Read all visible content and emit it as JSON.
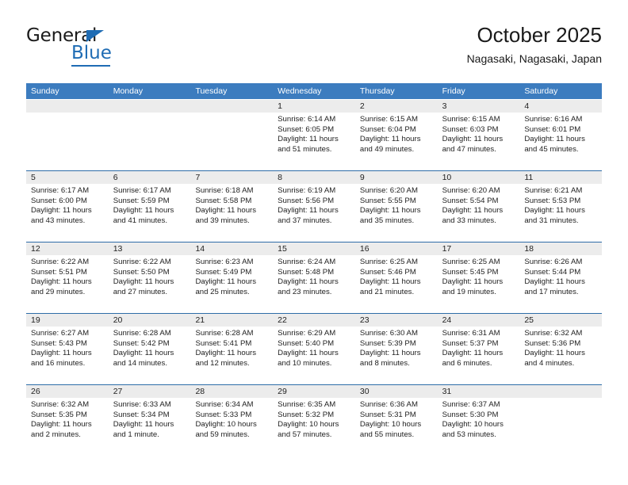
{
  "brand": {
    "name_top": "General",
    "name_bottom": "Blue",
    "accent_color": "#1f6cb4",
    "triangle_icon": "logo-triangle-icon"
  },
  "header": {
    "title": "October 2025",
    "subtitle": "Nagasaki, Nagasaki, Japan"
  },
  "calendar": {
    "header_bg": "#3c7cbf",
    "row_rule_color": "#2e6da8",
    "daynum_bg": "#ececec",
    "weekdays": [
      "Sunday",
      "Monday",
      "Tuesday",
      "Wednesday",
      "Thursday",
      "Friday",
      "Saturday"
    ],
    "weeks": [
      [
        {
          "day": "",
          "empty": true,
          "sunrise": "",
          "sunset": "",
          "daylight_line1": "",
          "daylight_line2": ""
        },
        {
          "day": "",
          "empty": true,
          "sunrise": "",
          "sunset": "",
          "daylight_line1": "",
          "daylight_line2": ""
        },
        {
          "day": "",
          "empty": true,
          "sunrise": "",
          "sunset": "",
          "daylight_line1": "",
          "daylight_line2": ""
        },
        {
          "day": "1",
          "empty": false,
          "sunrise": "Sunrise: 6:14 AM",
          "sunset": "Sunset: 6:05 PM",
          "daylight_line1": "Daylight: 11 hours",
          "daylight_line2": "and 51 minutes."
        },
        {
          "day": "2",
          "empty": false,
          "sunrise": "Sunrise: 6:15 AM",
          "sunset": "Sunset: 6:04 PM",
          "daylight_line1": "Daylight: 11 hours",
          "daylight_line2": "and 49 minutes."
        },
        {
          "day": "3",
          "empty": false,
          "sunrise": "Sunrise: 6:15 AM",
          "sunset": "Sunset: 6:03 PM",
          "daylight_line1": "Daylight: 11 hours",
          "daylight_line2": "and 47 minutes."
        },
        {
          "day": "4",
          "empty": false,
          "sunrise": "Sunrise: 6:16 AM",
          "sunset": "Sunset: 6:01 PM",
          "daylight_line1": "Daylight: 11 hours",
          "daylight_line2": "and 45 minutes."
        }
      ],
      [
        {
          "day": "5",
          "empty": false,
          "sunrise": "Sunrise: 6:17 AM",
          "sunset": "Sunset: 6:00 PM",
          "daylight_line1": "Daylight: 11 hours",
          "daylight_line2": "and 43 minutes."
        },
        {
          "day": "6",
          "empty": false,
          "sunrise": "Sunrise: 6:17 AM",
          "sunset": "Sunset: 5:59 PM",
          "daylight_line1": "Daylight: 11 hours",
          "daylight_line2": "and 41 minutes."
        },
        {
          "day": "7",
          "empty": false,
          "sunrise": "Sunrise: 6:18 AM",
          "sunset": "Sunset: 5:58 PM",
          "daylight_line1": "Daylight: 11 hours",
          "daylight_line2": "and 39 minutes."
        },
        {
          "day": "8",
          "empty": false,
          "sunrise": "Sunrise: 6:19 AM",
          "sunset": "Sunset: 5:56 PM",
          "daylight_line1": "Daylight: 11 hours",
          "daylight_line2": "and 37 minutes."
        },
        {
          "day": "9",
          "empty": false,
          "sunrise": "Sunrise: 6:20 AM",
          "sunset": "Sunset: 5:55 PM",
          "daylight_line1": "Daylight: 11 hours",
          "daylight_line2": "and 35 minutes."
        },
        {
          "day": "10",
          "empty": false,
          "sunrise": "Sunrise: 6:20 AM",
          "sunset": "Sunset: 5:54 PM",
          "daylight_line1": "Daylight: 11 hours",
          "daylight_line2": "and 33 minutes."
        },
        {
          "day": "11",
          "empty": false,
          "sunrise": "Sunrise: 6:21 AM",
          "sunset": "Sunset: 5:53 PM",
          "daylight_line1": "Daylight: 11 hours",
          "daylight_line2": "and 31 minutes."
        }
      ],
      [
        {
          "day": "12",
          "empty": false,
          "sunrise": "Sunrise: 6:22 AM",
          "sunset": "Sunset: 5:51 PM",
          "daylight_line1": "Daylight: 11 hours",
          "daylight_line2": "and 29 minutes."
        },
        {
          "day": "13",
          "empty": false,
          "sunrise": "Sunrise: 6:22 AM",
          "sunset": "Sunset: 5:50 PM",
          "daylight_line1": "Daylight: 11 hours",
          "daylight_line2": "and 27 minutes."
        },
        {
          "day": "14",
          "empty": false,
          "sunrise": "Sunrise: 6:23 AM",
          "sunset": "Sunset: 5:49 PM",
          "daylight_line1": "Daylight: 11 hours",
          "daylight_line2": "and 25 minutes."
        },
        {
          "day": "15",
          "empty": false,
          "sunrise": "Sunrise: 6:24 AM",
          "sunset": "Sunset: 5:48 PM",
          "daylight_line1": "Daylight: 11 hours",
          "daylight_line2": "and 23 minutes."
        },
        {
          "day": "16",
          "empty": false,
          "sunrise": "Sunrise: 6:25 AM",
          "sunset": "Sunset: 5:46 PM",
          "daylight_line1": "Daylight: 11 hours",
          "daylight_line2": "and 21 minutes."
        },
        {
          "day": "17",
          "empty": false,
          "sunrise": "Sunrise: 6:25 AM",
          "sunset": "Sunset: 5:45 PM",
          "daylight_line1": "Daylight: 11 hours",
          "daylight_line2": "and 19 minutes."
        },
        {
          "day": "18",
          "empty": false,
          "sunrise": "Sunrise: 6:26 AM",
          "sunset": "Sunset: 5:44 PM",
          "daylight_line1": "Daylight: 11 hours",
          "daylight_line2": "and 17 minutes."
        }
      ],
      [
        {
          "day": "19",
          "empty": false,
          "sunrise": "Sunrise: 6:27 AM",
          "sunset": "Sunset: 5:43 PM",
          "daylight_line1": "Daylight: 11 hours",
          "daylight_line2": "and 16 minutes."
        },
        {
          "day": "20",
          "empty": false,
          "sunrise": "Sunrise: 6:28 AM",
          "sunset": "Sunset: 5:42 PM",
          "daylight_line1": "Daylight: 11 hours",
          "daylight_line2": "and 14 minutes."
        },
        {
          "day": "21",
          "empty": false,
          "sunrise": "Sunrise: 6:28 AM",
          "sunset": "Sunset: 5:41 PM",
          "daylight_line1": "Daylight: 11 hours",
          "daylight_line2": "and 12 minutes."
        },
        {
          "day": "22",
          "empty": false,
          "sunrise": "Sunrise: 6:29 AM",
          "sunset": "Sunset: 5:40 PM",
          "daylight_line1": "Daylight: 11 hours",
          "daylight_line2": "and 10 minutes."
        },
        {
          "day": "23",
          "empty": false,
          "sunrise": "Sunrise: 6:30 AM",
          "sunset": "Sunset: 5:39 PM",
          "daylight_line1": "Daylight: 11 hours",
          "daylight_line2": "and 8 minutes."
        },
        {
          "day": "24",
          "empty": false,
          "sunrise": "Sunrise: 6:31 AM",
          "sunset": "Sunset: 5:37 PM",
          "daylight_line1": "Daylight: 11 hours",
          "daylight_line2": "and 6 minutes."
        },
        {
          "day": "25",
          "empty": false,
          "sunrise": "Sunrise: 6:32 AM",
          "sunset": "Sunset: 5:36 PM",
          "daylight_line1": "Daylight: 11 hours",
          "daylight_line2": "and 4 minutes."
        }
      ],
      [
        {
          "day": "26",
          "empty": false,
          "sunrise": "Sunrise: 6:32 AM",
          "sunset": "Sunset: 5:35 PM",
          "daylight_line1": "Daylight: 11 hours",
          "daylight_line2": "and 2 minutes."
        },
        {
          "day": "27",
          "empty": false,
          "sunrise": "Sunrise: 6:33 AM",
          "sunset": "Sunset: 5:34 PM",
          "daylight_line1": "Daylight: 11 hours",
          "daylight_line2": "and 1 minute."
        },
        {
          "day": "28",
          "empty": false,
          "sunrise": "Sunrise: 6:34 AM",
          "sunset": "Sunset: 5:33 PM",
          "daylight_line1": "Daylight: 10 hours",
          "daylight_line2": "and 59 minutes."
        },
        {
          "day": "29",
          "empty": false,
          "sunrise": "Sunrise: 6:35 AM",
          "sunset": "Sunset: 5:32 PM",
          "daylight_line1": "Daylight: 10 hours",
          "daylight_line2": "and 57 minutes."
        },
        {
          "day": "30",
          "empty": false,
          "sunrise": "Sunrise: 6:36 AM",
          "sunset": "Sunset: 5:31 PM",
          "daylight_line1": "Daylight: 10 hours",
          "daylight_line2": "and 55 minutes."
        },
        {
          "day": "31",
          "empty": false,
          "sunrise": "Sunrise: 6:37 AM",
          "sunset": "Sunset: 5:30 PM",
          "daylight_line1": "Daylight: 10 hours",
          "daylight_line2": "and 53 minutes."
        },
        {
          "day": "",
          "empty": true,
          "sunrise": "",
          "sunset": "",
          "daylight_line1": "",
          "daylight_line2": ""
        }
      ]
    ]
  }
}
